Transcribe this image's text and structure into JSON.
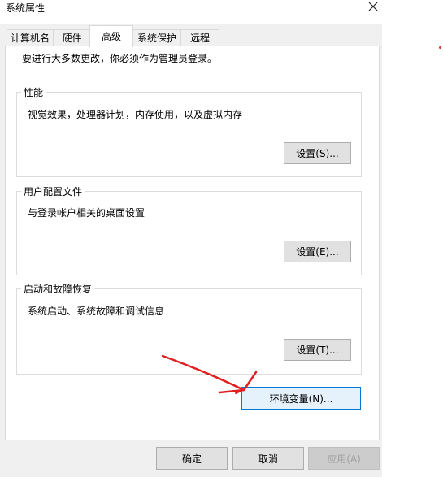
{
  "window": {
    "title": "系统属性",
    "close_glyph": "✕"
  },
  "tabs": [
    {
      "label": "计算机名"
    },
    {
      "label": "硬件"
    },
    {
      "label": "高级",
      "active": true
    },
    {
      "label": "系统保护"
    },
    {
      "label": "远程"
    }
  ],
  "panel": {
    "admin_note": "要进行大多数更改，你必须作为管理员登录。",
    "groups": [
      {
        "title": "性能",
        "desc": "视觉效果，处理器计划，内存使用，以及虚拟内存",
        "button": "设置(S)..."
      },
      {
        "title": "用户配置文件",
        "desc": "与登录帐户相关的桌面设置",
        "button": "设置(E)..."
      },
      {
        "title": "启动和故障恢复",
        "desc": "系统启动、系统故障和调试信息",
        "button": "设置(T)..."
      }
    ],
    "env_button": "环境变量(N)..."
  },
  "footer": {
    "ok": "确定",
    "cancel": "取消",
    "apply": "应用(A)"
  },
  "annotation": {
    "color": "#e02020"
  }
}
